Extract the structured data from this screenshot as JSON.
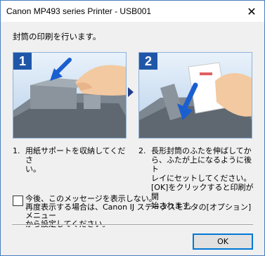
{
  "window": {
    "title": "Canon MP493 series Printer - USB001",
    "close_glyph": "✕"
  },
  "heading": "封筒の印刷を行います。",
  "steps": [
    {
      "badge": "1",
      "number": "1.",
      "text": "用紙サポートを収納してくださ\nい。"
    },
    {
      "badge": "2",
      "number": "2.",
      "text": "長形封筒のふたを伸ばしてか\nら、ふたが上になるように後ト\nレイにセットしてください。\n[OK]をクリックすると印刷が開\n始されます。"
    }
  ],
  "checkbox": {
    "checked": false,
    "label": "今後、このメッセージを表示しない。\n再度表示する場合は、Canon IJ ステータスモニタの[オプション]メニュー\nから設定してください。"
  },
  "ok_label": "OK",
  "colors": {
    "step_badge": "#1f57a8",
    "arrow": "#1a5fd0",
    "panel_top": "#e9f2fb",
    "panel_bottom": "#b7cfea"
  }
}
